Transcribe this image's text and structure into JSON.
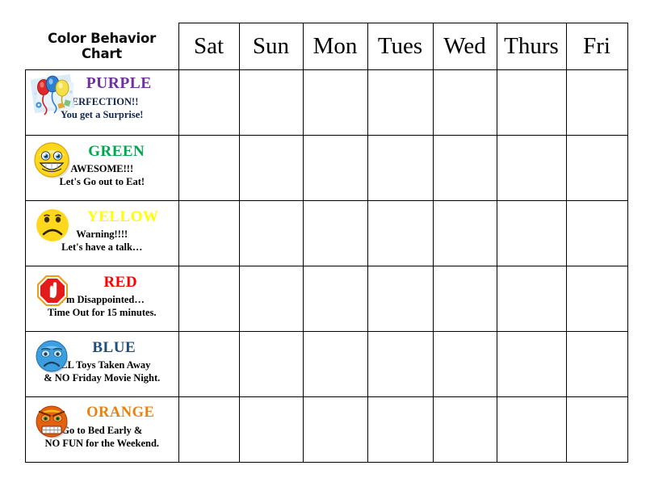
{
  "title": {
    "line1": "Color Behavior",
    "line2": "Chart"
  },
  "columns": [
    {
      "key": "sat",
      "label": "Sat"
    },
    {
      "key": "sun",
      "label": "Sun"
    },
    {
      "key": "mon",
      "label": "Mon"
    },
    {
      "key": "tues",
      "label": "Tues"
    },
    {
      "key": "wed",
      "label": "Wed"
    },
    {
      "key": "thurs",
      "label": "Thurs"
    },
    {
      "key": "fri",
      "label": "Fri"
    }
  ],
  "rows": [
    {
      "color_name": "PURPLE",
      "color_hex": "#7030A0",
      "icon": "balloons-party-icon",
      "line1": "PERFECTION!!",
      "line2": "You get a Surprise!",
      "cells": [
        "",
        "",
        "",
        "",
        "",
        "",
        ""
      ]
    },
    {
      "color_name": "GREEN",
      "color_hex": "#00A550",
      "icon": "grinning-face-icon",
      "line1": "AWESOME!!!",
      "line2": "Let's Go out to Eat!",
      "cells": [
        "",
        "",
        "",
        "",
        "",
        "",
        ""
      ]
    },
    {
      "color_name": "YELLOW",
      "color_hex": "#FFFF00",
      "icon": "sad-face-yellow-icon",
      "line1": "Warning!!!!",
      "line2": "Let's have a talk…",
      "cells": [
        "",
        "",
        "",
        "",
        "",
        "",
        ""
      ]
    },
    {
      "color_name": "RED",
      "color_hex": "#FF0000",
      "icon": "stop-sign-hand-icon",
      "line1": "I'm Disappointed…",
      "line2": "Time Out for 15 minutes.",
      "cells": [
        "",
        "",
        "",
        "",
        "",
        "",
        ""
      ]
    },
    {
      "color_name": "BLUE",
      "color_hex": "#1F4E79",
      "icon": "sad-face-blue-icon",
      "line1": "ALL Toys Taken Away",
      "line2": "& NO Friday Movie Night.",
      "cells": [
        "",
        "",
        "",
        "",
        "",
        "",
        ""
      ]
    },
    {
      "color_name": "ORANGE",
      "color_hex": "#E8820C",
      "icon": "angry-face-orange-icon",
      "line1": "Go to Bed Early &",
      "line2": "NO FUN for the Weekend.",
      "cells": [
        "",
        "",
        "",
        "",
        "",
        "",
        ""
      ]
    }
  ]
}
